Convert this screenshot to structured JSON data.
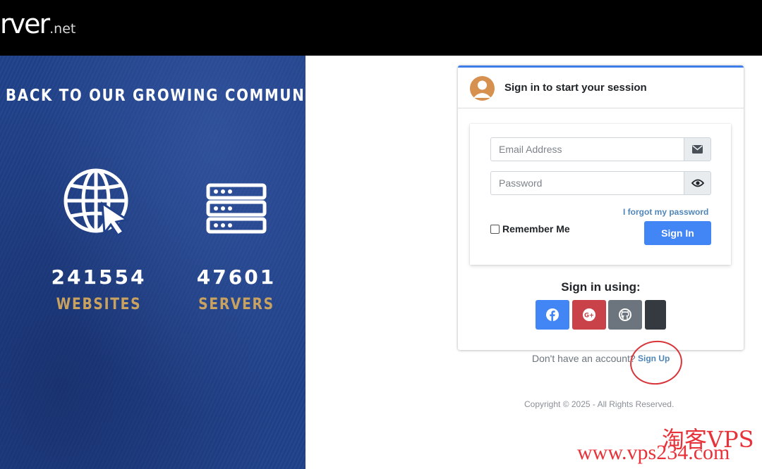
{
  "header": {
    "logo_main": "rver",
    "logo_tld": ".net"
  },
  "hero": {
    "title": "BACK TO OUR GROWING COMMUNITY",
    "stats": [
      {
        "number": "241554",
        "label": "WEBSITES",
        "icon": "globe-cursor-icon"
      },
      {
        "number": "47601",
        "label": "SERVERS",
        "icon": "server-rack-icon"
      }
    ]
  },
  "login": {
    "title": "Sign in to start your session",
    "email_placeholder": "Email Address",
    "password_placeholder": "Password",
    "forgot_password": "I forgot my password",
    "remember_me": "Remember Me",
    "sign_in": "Sign In",
    "sign_in_using": "Sign in using:",
    "social_buttons": [
      {
        "name": "facebook",
        "icon": "facebook-icon",
        "color": "#4285f4"
      },
      {
        "name": "google-plus",
        "icon": "google-plus-icon",
        "color": "#c9424a"
      },
      {
        "name": "github",
        "icon": "github-icon",
        "color": "#6c757d"
      },
      {
        "name": "other",
        "icon": "",
        "color": "#343a40"
      }
    ],
    "accent_color": "#3f7ee8"
  },
  "footer": {
    "no_account": "Don't have an account?",
    "sign_up": "Sign Up",
    "copyright": "Copyright © 2025 - All Rights Reserved."
  },
  "watermark": {
    "cn": "淘客VPS",
    "url": "www.vps234.com"
  }
}
